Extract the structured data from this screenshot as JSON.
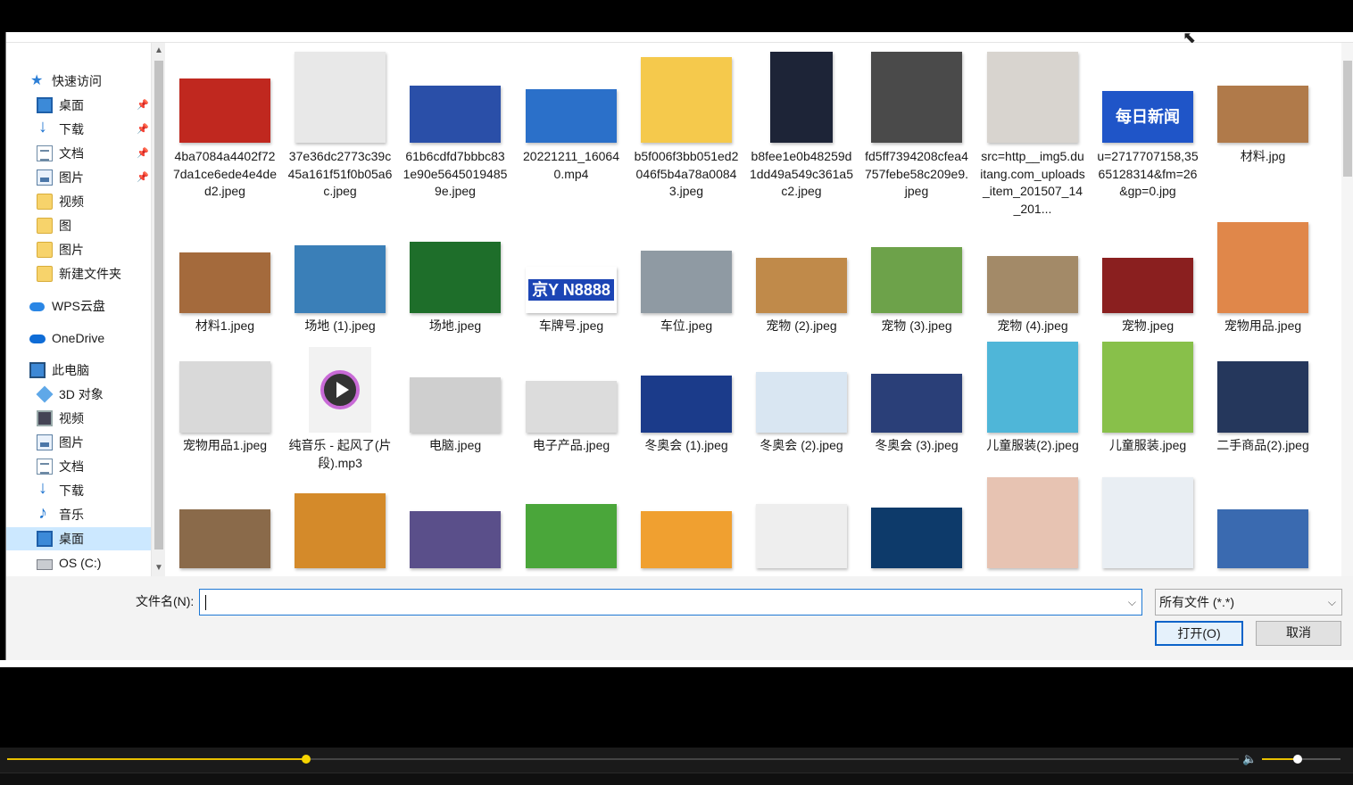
{
  "nav": {
    "items": [
      {
        "label": "快速访问",
        "icon": "star-icon",
        "pinned": false
      },
      {
        "label": "桌面",
        "icon": "desktop-icon",
        "pinned": true
      },
      {
        "label": "下载",
        "icon": "download-icon",
        "pinned": true
      },
      {
        "label": "文档",
        "icon": "document-icon",
        "pinned": true
      },
      {
        "label": "图片",
        "icon": "pictures-icon",
        "pinned": true
      },
      {
        "label": "视频",
        "icon": "folder-icon",
        "pinned": false
      },
      {
        "label": "图",
        "icon": "folder-icon",
        "pinned": false
      },
      {
        "label": "图片",
        "icon": "folder-icon",
        "pinned": false
      },
      {
        "label": "新建文件夹",
        "icon": "folder-icon",
        "pinned": false
      },
      {
        "label": "WPS云盘",
        "icon": "cloud-icon",
        "pinned": false
      },
      {
        "label": "OneDrive",
        "icon": "onedrive-icon",
        "pinned": false
      },
      {
        "label": "此电脑",
        "icon": "computer-icon",
        "pinned": false
      },
      {
        "label": "3D 对象",
        "icon": "3d-objects-icon",
        "pinned": false
      },
      {
        "label": "视频",
        "icon": "video-icon",
        "pinned": false
      },
      {
        "label": "图片",
        "icon": "pictures-icon",
        "pinned": false
      },
      {
        "label": "文档",
        "icon": "document-icon",
        "pinned": false
      },
      {
        "label": "下载",
        "icon": "download-icon",
        "pinned": false
      },
      {
        "label": "音乐",
        "icon": "music-icon",
        "pinned": false
      },
      {
        "label": "桌面",
        "icon": "desktop-icon",
        "pinned": false,
        "selected": true
      },
      {
        "label": "OS (C:)",
        "icon": "drive-icon",
        "pinned": false
      }
    ]
  },
  "files": [
    {
      "label": "4ba7084a4402f727da1ce6ede4e4ded2.jpeg",
      "color": "#c0281f"
    },
    {
      "label": "37e36dc2773c39c45a161f51f0b05a6c.jpeg",
      "color": "#e8e8e8"
    },
    {
      "label": "61b6cdfd7bbbc831e90e56450194859e.jpeg",
      "color": "#2a4fa8"
    },
    {
      "label": "20221211_160640.mp4",
      "color": "#2b70c9"
    },
    {
      "label": "b5f006f3bb051ed2046f5b4a78a00843.jpeg",
      "color": "#f5c94c"
    },
    {
      "label": "b8fee1e0b48259d1dd49a549c361a5c2.jpeg",
      "color": "#1d2437"
    },
    {
      "label": "fd5ff7394208cfea4757febe58c209e9.jpeg",
      "color": "#4a4a4a"
    },
    {
      "label": "src=http__img5.duitang.com_uploads_item_201507_14_201...",
      "color": "#d8d4cf"
    },
    {
      "label": "u=2717707158,3565128314&fm=26&gp=0.jpg",
      "color": "#1f55c8",
      "text": "每日新闻"
    },
    {
      "label": "材料.jpg",
      "color": "#b07a4a"
    },
    {
      "label": "材料1.jpeg",
      "color": "#a46a3c"
    },
    {
      "label": "场地 (1).jpeg",
      "color": "#3a7fb8"
    },
    {
      "label": "场地.jpeg",
      "color": "#1e6e2a"
    },
    {
      "label": "车牌号.jpeg",
      "color": "#1c45b5",
      "text": "京Y N8888"
    },
    {
      "label": "车位.jpeg",
      "color": "#8f9aa3"
    },
    {
      "label": "宠物 (2).jpeg",
      "color": "#c08a4a"
    },
    {
      "label": "宠物 (3).jpeg",
      "color": "#6da24a"
    },
    {
      "label": "宠物 (4).jpeg",
      "color": "#a38a68"
    },
    {
      "label": "宠物.jpeg",
      "color": "#8a1f1f"
    },
    {
      "label": "宠物用品.jpeg",
      "color": "#e0874a"
    },
    {
      "label": "宠物用品1.jpeg",
      "color": "#d9d9d9"
    },
    {
      "label": "纯音乐 - 起风了(片段).mp3",
      "color": "#f2f2f2"
    },
    {
      "label": "电脑.jpeg",
      "color": "#cfcfcf"
    },
    {
      "label": "电子产品.jpeg",
      "color": "#dcdcdc"
    },
    {
      "label": "冬奥会 (1).jpeg",
      "color": "#1b3b8a"
    },
    {
      "label": "冬奥会 (2).jpeg",
      "color": "#d9e6f2"
    },
    {
      "label": "冬奥会 (3).jpeg",
      "color": "#2a3f78"
    },
    {
      "label": "儿童服装(2).jpeg",
      "color": "#4fb6d8"
    },
    {
      "label": "儿童服装.jpeg",
      "color": "#88c04a"
    },
    {
      "label": "二手商品(2).jpeg",
      "color": "#25375c"
    },
    {
      "label": "",
      "color": "#8a6a4a"
    },
    {
      "label": "",
      "color": "#d48a2a"
    },
    {
      "label": "",
      "color": "#5a4f8a"
    },
    {
      "label": "",
      "color": "#4aa63a"
    },
    {
      "label": "",
      "color": "#f0a030"
    },
    {
      "label": "",
      "color": "#eeeeee"
    },
    {
      "label": "",
      "color": "#0d3a6a"
    },
    {
      "label": "",
      "color": "#e7c3b2"
    },
    {
      "label": "",
      "color": "#e9eef3"
    },
    {
      "label": "",
      "color": "#3a6ab0"
    }
  ],
  "footer": {
    "filename_label": "文件名(N):",
    "filename_value": "",
    "filetype_value": "所有文件 (*.*)",
    "open_label": "打开(O)",
    "cancel_label": "取消"
  },
  "player": {
    "progress": 0.243,
    "volume": 0.45,
    "accent": "#e8c000"
  }
}
